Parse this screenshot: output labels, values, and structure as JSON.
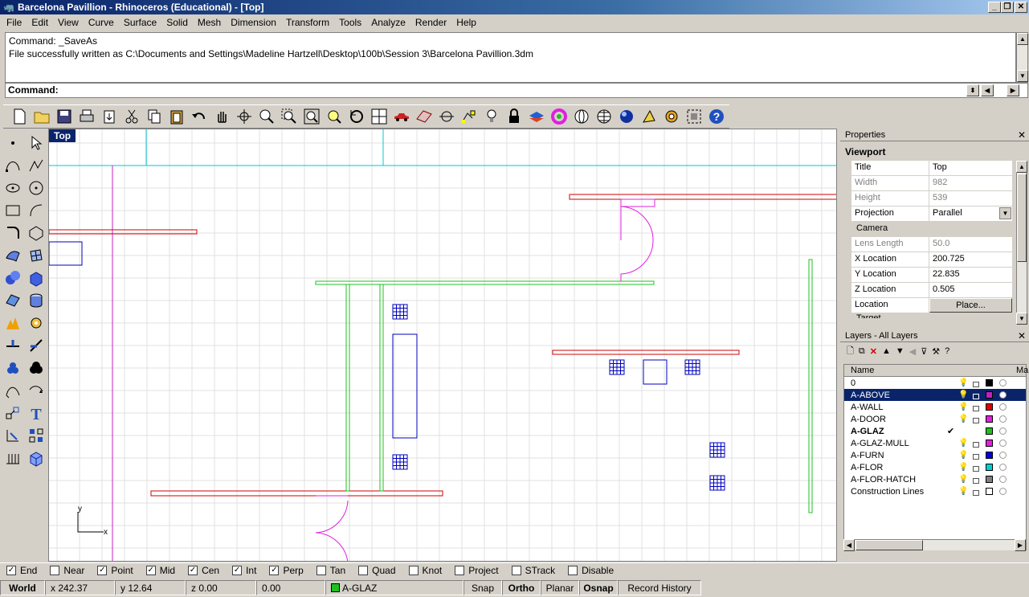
{
  "window": {
    "title": "Barcelona Pavillion - Rhinoceros (Educational) - [Top]"
  },
  "menu": [
    "File",
    "Edit",
    "View",
    "Curve",
    "Surface",
    "Solid",
    "Mesh",
    "Dimension",
    "Transform",
    "Tools",
    "Analyze",
    "Render",
    "Help"
  ],
  "command": {
    "history_line1": "Command: _SaveAs",
    "history_line2": "File successfully written as C:\\Documents and Settings\\Madeline Hartzell\\Desktop\\100b\\Session 3\\Barcelona Pavillion.3dm",
    "prompt": "Command:"
  },
  "toolbar_icons": [
    "new-icon",
    "open-icon",
    "save-icon",
    "print-icon",
    "import-icon",
    "cut-icon",
    "copy-icon",
    "paste-icon",
    "undo-icon",
    "pan-icon",
    "rotate-view-icon",
    "zoom-icon",
    "zoom-window-icon",
    "zoom-extents-icon",
    "zoom-selected-icon",
    "undo-view-icon",
    "four-viewports-icon",
    "car-icon",
    "grid-icon",
    "osnap-icon",
    "select-points-icon",
    "light-icon",
    "lock-icon",
    "layer-icon",
    "color-icon",
    "shade-icon",
    "wireframe-icon",
    "render-icon",
    "gumball-icon",
    "settings-icon",
    "options-icon",
    "help-icon"
  ],
  "viewport": {
    "label": "Top",
    "axis_x": "x",
    "axis_y": "y"
  },
  "properties": {
    "panel_title": "Properties",
    "section": "Viewport",
    "rows": [
      {
        "k": "Title",
        "v": "Top"
      },
      {
        "k": "Width",
        "v": "982"
      },
      {
        "k": "Height",
        "v": "539"
      },
      {
        "k": "Projection",
        "v": "Parallel"
      }
    ],
    "camera_label": "Camera",
    "camera_rows": [
      {
        "k": "Lens Length",
        "v": "50.0"
      },
      {
        "k": "X Location",
        "v": "200.725"
      },
      {
        "k": "Y Location",
        "v": "22.835"
      },
      {
        "k": "Z Location",
        "v": "0.505"
      },
      {
        "k": "Location",
        "v": "Place..."
      }
    ],
    "next_label": "Target"
  },
  "layers": {
    "panel_title": "Layers - All Layers",
    "col_name": "Name",
    "col_mat": "Ma",
    "items": [
      {
        "name": "0",
        "color": "#000000"
      },
      {
        "name": "A-ABOVE",
        "color": "#c020c0"
      },
      {
        "name": "A-WALL",
        "color": "#e00000"
      },
      {
        "name": "A-DOOR",
        "color": "#e020e0"
      },
      {
        "name": "A-GLAZ",
        "color": "#20c020"
      },
      {
        "name": "A-GLAZ-MULL",
        "color": "#e020e0"
      },
      {
        "name": "A-FURN",
        "color": "#0000e0"
      },
      {
        "name": "A-FLOR",
        "color": "#00d0d0"
      },
      {
        "name": "A-FLOR-HATCH",
        "color": "#808080"
      },
      {
        "name": "Construction Lines",
        "color": "#ffffff"
      }
    ],
    "current_mark": "✔"
  },
  "osnap": [
    {
      "label": "End",
      "checked": true
    },
    {
      "label": "Near",
      "checked": false
    },
    {
      "label": "Point",
      "checked": true
    },
    {
      "label": "Mid",
      "checked": true
    },
    {
      "label": "Cen",
      "checked": true
    },
    {
      "label": "Int",
      "checked": true
    },
    {
      "label": "Perp",
      "checked": true
    },
    {
      "label": "Tan",
      "checked": false
    },
    {
      "label": "Quad",
      "checked": false
    },
    {
      "label": "Knot",
      "checked": false
    },
    {
      "label": "Project",
      "checked": false
    },
    {
      "label": "STrack",
      "checked": false
    },
    {
      "label": "Disable",
      "checked": false
    }
  ],
  "status": {
    "cplane": "World",
    "x": "x 242.37",
    "y": "y 12.64",
    "z": "z 0.00",
    "d": "0.00",
    "layer": "A-GLAZ",
    "layer_color": "#20c020",
    "snap": "Snap",
    "ortho": "Ortho",
    "planar": "Planar",
    "osnap": "Osnap",
    "record": "Record History"
  },
  "colors": {
    "wall": "#d00000",
    "glass": "#20c020",
    "door": "#e020e0",
    "furniture": "#0000c0",
    "construction": "#00c8d8",
    "grid": "#e0e0e0"
  }
}
